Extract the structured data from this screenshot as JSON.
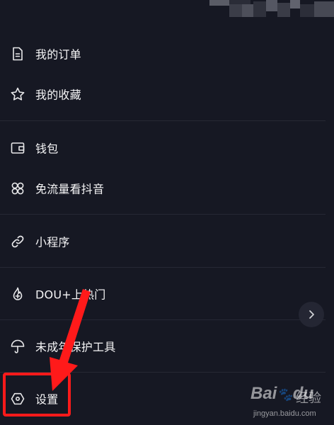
{
  "menu": {
    "items": [
      {
        "label": "我的订单",
        "icon": "document-icon"
      },
      {
        "label": "我的收藏",
        "icon": "star-icon"
      },
      {
        "label": "钱包",
        "icon": "wallet-icon"
      },
      {
        "label": "免流量看抖音",
        "icon": "clover-icon"
      },
      {
        "label": "小程序",
        "icon": "link-icon"
      },
      {
        "label": "DOU+上热门",
        "icon": "flame-plus-icon"
      },
      {
        "label": "未成年保护工具",
        "icon": "umbrella-icon"
      },
      {
        "label": "设置",
        "icon": "hexagon-settings-icon"
      }
    ]
  },
  "watermark": {
    "logo_text": "Bai",
    "logo_text2": "du",
    "jingyan": "经验",
    "url": "jingyan.baidu.com"
  },
  "colors": {
    "background": "#161823",
    "text": "#f5f5f6",
    "annotation_red": "#ff1a1a"
  }
}
